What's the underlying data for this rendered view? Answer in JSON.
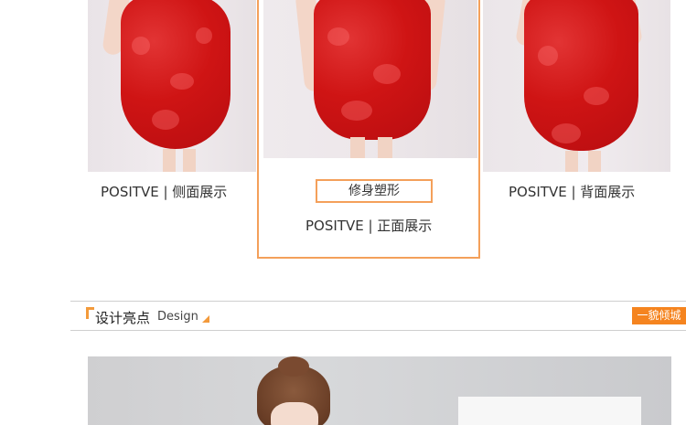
{
  "views": {
    "side": {
      "caption": "POSITVE | 侧面展示"
    },
    "front": {
      "tag": "修身塑形",
      "caption": "POSITVE | 正面展示"
    },
    "back": {
      "caption": "POSITVE | 背面展示"
    }
  },
  "section": {
    "title": "设计亮点",
    "subtitle": "Design",
    "badge": "一貌倾城"
  },
  "colors": {
    "accent_orange": "#f5841f",
    "frame_orange": "#f4a05a",
    "dress_red": "#cf1414"
  }
}
